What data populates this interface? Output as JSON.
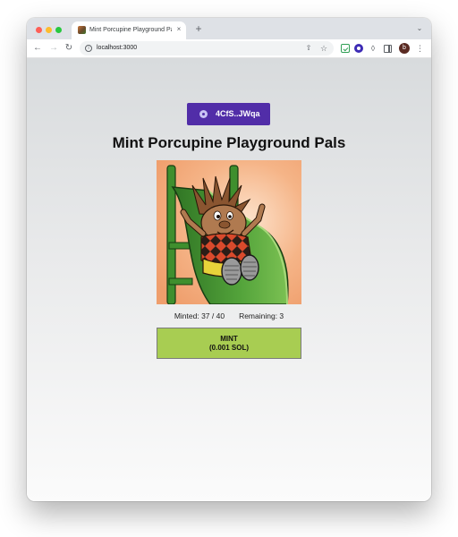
{
  "browser": {
    "tab_title": "Mint Porcupine Playground Pals",
    "tab_close": "×",
    "new_tab": "+",
    "tab_menu": "⌄",
    "url": "localhost:3000",
    "profile_initial": "b"
  },
  "icons": {
    "back": "back-arrow-icon",
    "forward": "forward-arrow-icon",
    "reload": "reload-icon",
    "info": "info-icon",
    "share": "share-icon",
    "bookmark": "star-icon",
    "extension_green": "checkbox-extension-icon",
    "extension_phantom": "phantom-extension-icon",
    "extensions": "puzzle-icon",
    "side_panel": "side-panel-icon",
    "menu": "kebab-menu-icon",
    "wallet": "phantom-wallet-icon"
  },
  "page": {
    "wallet_label": "4CfS..JWqa",
    "title": "Mint Porcupine Playground Pals",
    "minted_label": "Minted: 37 / 40",
    "remaining_label": "Remaining: 3",
    "mint_line1": "MINT",
    "mint_line2": "(0.001 SOL)"
  },
  "colors": {
    "wallet_button": "#512da8",
    "mint_button": "#a8cd52",
    "image_background": "#f2a676",
    "slide_green": "#3f8f2e"
  }
}
